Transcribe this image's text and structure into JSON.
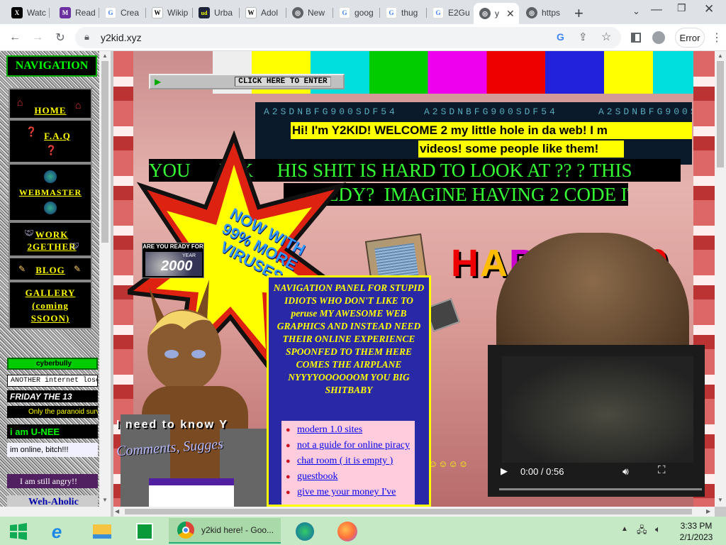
{
  "browser": {
    "tabs": [
      {
        "label": "Watc",
        "icon": "x-icon",
        "color": "#000000"
      },
      {
        "label": "Read",
        "icon": "medium-icon",
        "color": "#6b2fa0"
      },
      {
        "label": "Crea",
        "icon": "google-icon",
        "color": "#4285f4"
      },
      {
        "label": "Wikip",
        "icon": "wikipedia-icon",
        "color": "#000000"
      },
      {
        "label": "Urba",
        "icon": "urban-dictionary-icon",
        "color": "#1d2439"
      },
      {
        "label": "Adol",
        "icon": "wikipedia-icon",
        "color": "#000000"
      },
      {
        "label": "New",
        "icon": "globe-icon",
        "color": "#5f6368"
      },
      {
        "label": "goog",
        "icon": "google-icon",
        "color": "#4285f4"
      },
      {
        "label": "thug",
        "icon": "google-icon",
        "color": "#4285f4"
      },
      {
        "label": "E2Gu",
        "icon": "google-icon",
        "color": "#4285f4"
      },
      {
        "label": "y",
        "icon": "globe-icon",
        "color": "#5f6368",
        "active": true
      },
      {
        "label": "https",
        "icon": "globe-icon",
        "color": "#5f6368"
      }
    ],
    "new_tab_glyph": "+",
    "url": "y2kid.xyz",
    "error_label": "Error"
  },
  "left_nav": {
    "title": "NAVIGATION",
    "items": [
      {
        "label": "HOME"
      },
      {
        "label": "F.A.Q"
      },
      {
        "label": "WEBMASTER"
      },
      {
        "label": "WORK 2GETHER"
      },
      {
        "label": "BLOG"
      },
      {
        "label": "GALLERY (coming SSOON)"
      }
    ],
    "banners": [
      "cyberbully",
      "ANOTHER internet lose",
      "FRIDAY THE 13",
      "Only the paranoid surv",
      "i am U-NEE",
      "im online, bitch!!!",
      "I am still angry!!",
      "Weh-Aholic"
    ]
  },
  "main": {
    "enter_button": "CLICK HERE TO ENTER",
    "marquee_code": "A2SDNBFG900SDF54",
    "welcome_line1": "Hi! I'm Y2KID! WELCOME 2 my little hole in da web! I m",
    "welcome_line2": "videos! some people like them!",
    "hard_line1": "YOU      INK     HIS SHIT IS HARD TO LOOK AT ?? ? THIS",
    "hard_line2": "         EDY?  IMAGINE HAVING 2 CODE IT.",
    "starburst": "NOW WITH 99% MORE VIRUSES",
    "y2k_badge_top": "ARE YOU READY FOR",
    "y2k_badge_year": "2000",
    "y2k_badge_label": "YEAR",
    "happy": "HAPPY 200",
    "nav_panel_text": "NAVIGATION PANEL FOR STUPID IDIOTS WHO DON'T LIKE TO peruse MY AWESOME WEB GRAPHICS AND INSTEAD NEED THEIR ONLINE EXPERIENCE SPOONFED TO THEM HERE COMES THE AIRPLANE NYYYYOOOOOOM YOU BIG SHITBABY",
    "nav_links": [
      "modern 1.0 sites",
      "not a guide for online piracy",
      "chat room ( it is empty )",
      "guestbook",
      "give me your money I've"
    ],
    "need_to_know": "I need to know Y",
    "comments": "Comments, Sugges",
    "video_time": "0:00 / 0:56"
  },
  "taskbar": {
    "chrome_label": "y2kid here! - Goo...",
    "time": "3:33 PM",
    "date": "2/1/2023"
  }
}
